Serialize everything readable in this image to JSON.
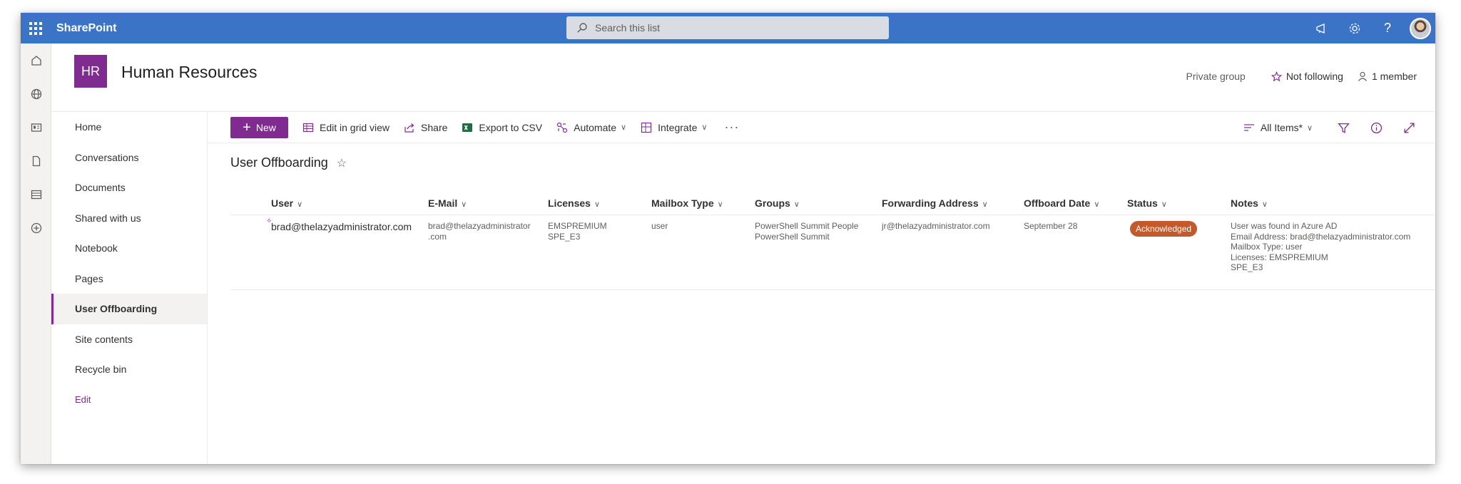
{
  "app": {
    "brand": "SharePoint"
  },
  "search": {
    "placeholder": "Search this list"
  },
  "site": {
    "logo": "HR",
    "title": "Human Resources",
    "privacy": "Private group",
    "follow": "Not following",
    "members": "1 member"
  },
  "nav": {
    "items": [
      {
        "label": "Home"
      },
      {
        "label": "Conversations"
      },
      {
        "label": "Documents"
      },
      {
        "label": "Shared with us"
      },
      {
        "label": "Notebook"
      },
      {
        "label": "Pages"
      },
      {
        "label": "User Offboarding",
        "active": true
      },
      {
        "label": "Site contents"
      },
      {
        "label": "Recycle bin"
      }
    ],
    "edit": "Edit"
  },
  "commands": {
    "new": "New",
    "grid": "Edit in grid view",
    "share": "Share",
    "export": "Export to CSV",
    "automate": "Automate",
    "integrate": "Integrate",
    "more": "···",
    "view": "All Items*"
  },
  "list": {
    "title": "User Offboarding",
    "columns": {
      "user": "User",
      "email": "E-Mail",
      "licenses": "Licenses",
      "mailbox": "Mailbox Type",
      "groups": "Groups",
      "forwarding": "Forwarding Address",
      "offboard": "Offboard Date",
      "status": "Status",
      "notes": "Notes"
    },
    "row": {
      "user": "brad@thelazyadministrator.com",
      "email_1": "brad@thelazyadministrator",
      "email_2": ".com",
      "license_1": "EMSPREMIUM",
      "license_2": "SPE_E3",
      "mailbox": "user",
      "group_1": "PowerShell Summit People",
      "group_2": "PowerShell Summit",
      "forwarding": "jr@thelazyadministrator.com",
      "offboard": "September 28",
      "status": "Acknowledged",
      "note_1": "User was found in Azure AD",
      "note_2": "Email Address: brad@thelazyadministrator.com",
      "note_3": "Mailbox Type: user",
      "note_4": "Licenses: EMSPREMIUM",
      "note_5": "SPE_E3"
    }
  },
  "colors": {
    "suitebar": "#3b74c7",
    "accent": "#7f2b8f",
    "status": "#c35a2c"
  }
}
